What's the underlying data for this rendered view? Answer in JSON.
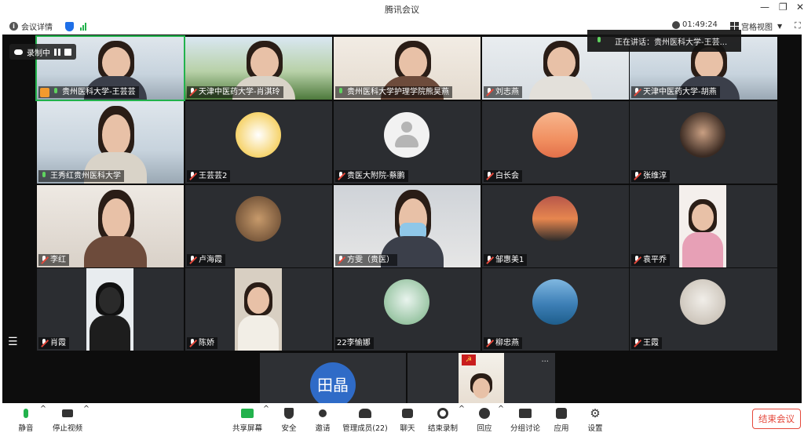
{
  "window": {
    "title": "腾讯会议"
  },
  "infobar": {
    "meeting_details": "会议详情",
    "timer": "01:49:24",
    "view_mode": "宫格视图"
  },
  "recording": {
    "status": "录制中"
  },
  "speaking": {
    "text": "正在讲话：贵州医科大学-王芸..."
  },
  "participants": [
    {
      "name": "贵州医科大学-王芸芸",
      "host": true,
      "mic": "on"
    },
    {
      "name": "天津中医药大学-肖淇玲",
      "mic": "off"
    },
    {
      "name": "贵州医科大学护理学院熊昊燕",
      "mic": "on"
    },
    {
      "name": "刘志燕",
      "mic": "off"
    },
    {
      "name": "天津中医药大学-胡燕",
      "mic": "off"
    },
    {
      "name": "王秀红贵州医科大学",
      "mic": "on"
    },
    {
      "name": "王芸芸2",
      "mic": "off"
    },
    {
      "name": "贵医大附院-蔡鹏",
      "mic": "off"
    },
    {
      "name": "白长会",
      "mic": "off"
    },
    {
      "name": "张维淳",
      "mic": "off"
    },
    {
      "name": "李红",
      "mic": "off"
    },
    {
      "name": "卢海霞",
      "mic": "off"
    },
    {
      "name": "方雯（贵医）",
      "mic": "off"
    },
    {
      "name": "邹惠美1",
      "mic": "off"
    },
    {
      "name": "袁平乔",
      "mic": "off"
    },
    {
      "name": "肖霞",
      "mic": "off"
    },
    {
      "name": "陈娇",
      "mic": "off"
    },
    {
      "name": "22李愉娜",
      "mic": "none"
    },
    {
      "name": "柳忠燕",
      "mic": "off"
    },
    {
      "name": "王霞",
      "mic": "off"
    }
  ],
  "strip": {
    "avatar_text": "田晶",
    "more": "···"
  },
  "toolbar": {
    "mute": "静音",
    "stop_video": "停止视频",
    "share_screen": "共享屏幕",
    "security": "安全",
    "invite": "邀请",
    "manage_members": "管理成员(22)",
    "chat": "聊天",
    "end_recording": "结束录制",
    "reactions": "回应",
    "breakout": "分组讨论",
    "apps": "应用",
    "settings": "设置",
    "end_meeting": "结束会议"
  },
  "colors": {
    "accent": "#1e6fe8",
    "danger": "#e5483b",
    "active_speaker": "#22b24c",
    "host_badge": "#f29a2e"
  }
}
